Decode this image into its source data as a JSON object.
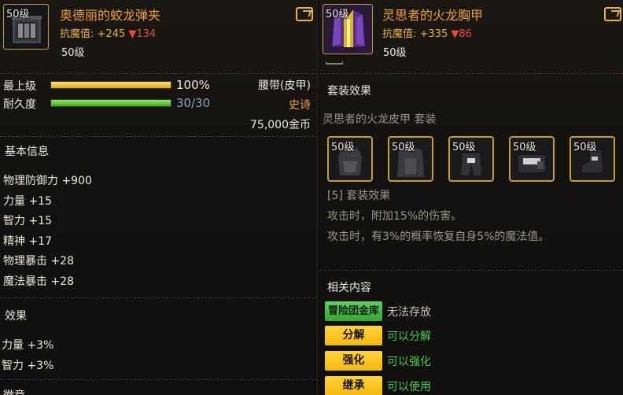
{
  "left": {
    "item": {
      "level": "50级",
      "name": "奥德丽的蛟龙弹夹",
      "stat_label": "抗魔值:",
      "stat_plus": "+245",
      "stat_minus": "▼134",
      "level_req": "50级"
    },
    "rows": {
      "max_level_label": "最上级",
      "max_level_value": "100%",
      "max_level_fill": 1.0,
      "durability_label": "耐久度",
      "durability_value": "30/30",
      "durability_fill": 1.0,
      "slot_type": "腰带(皮甲)",
      "rarity": "史诗",
      "price": "75,000金币"
    },
    "basic_info": {
      "title": "基本信息",
      "stats": [
        "物理防御力 +900",
        "力量 +15",
        "智力 +15",
        "精神 +17",
        "物理暴击 +28",
        "魔法暴击 +28"
      ]
    },
    "effects": {
      "title": "效果",
      "lines": [
        "力量 +3%",
        "智力 +3%"
      ]
    },
    "bottom_cut": "徽章"
  },
  "right": {
    "item": {
      "level": "50级",
      "name": "灵思者的火龙胸甲",
      "stat_label": "抗魔值:",
      "stat_plus": "+335",
      "stat_minus": "▼86",
      "level_req": "50级"
    },
    "set": {
      "title": "套装效果",
      "set_name": "灵思者的火龙皮甲  套装",
      "pieces": [
        {
          "level": "50级",
          "icon": "helmet-icon"
        },
        {
          "level": "50级",
          "icon": "chest-armor-icon"
        },
        {
          "level": "50级",
          "icon": "pants-icon"
        },
        {
          "level": "50级",
          "icon": "shoulder-icon"
        },
        {
          "level": "50级",
          "icon": "boots-icon"
        }
      ],
      "effect_header": "[5] 套装效果",
      "effect_lines": [
        "攻击时，附加15%的伤害。",
        "攻击时，有3%的概率恢复自身5%的魔法值。"
      ]
    },
    "related": {
      "title": "相关内容",
      "rows": [
        {
          "tag": "冒险团金库",
          "text": "无法存放",
          "tag_color": "#4cc24c",
          "text_color": "#c9c4bb"
        },
        {
          "tag": "分解",
          "text": "可以分解",
          "tag_color": "#f5c21e",
          "text_color": "#4ad04a"
        },
        {
          "tag": "强化",
          "text": "可以强化",
          "tag_color": "#f5c21e",
          "text_color": "#4ad04a"
        },
        {
          "tag": "继承",
          "text": "可以使用",
          "tag_color": "#f5c21e",
          "text_color": "#4ad04a"
        }
      ]
    }
  },
  "colors": {
    "gold": "#e8b23c",
    "title_orange": "#f0a030",
    "green": "#4ad04a",
    "red": "#e84a3a"
  }
}
